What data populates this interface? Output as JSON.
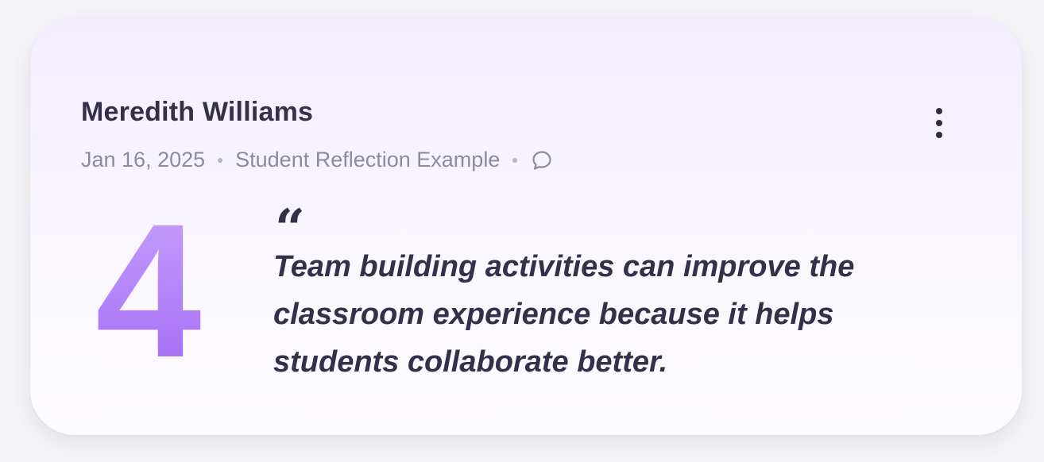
{
  "card": {
    "author": "Meredith Williams",
    "date": "Jan 16, 2025",
    "category": "Student Reflection Example",
    "score": "4",
    "quote_mark": "“",
    "quote": "Team building activities can improve the classroom experience because it helps students collaborate better.",
    "icons": {
      "menu": "more-vertical-icon",
      "comment": "comment-bubble-icon"
    },
    "colors": {
      "accent": "#b27cf8",
      "text": "#34304a",
      "muted": "#8d8a9c"
    }
  }
}
